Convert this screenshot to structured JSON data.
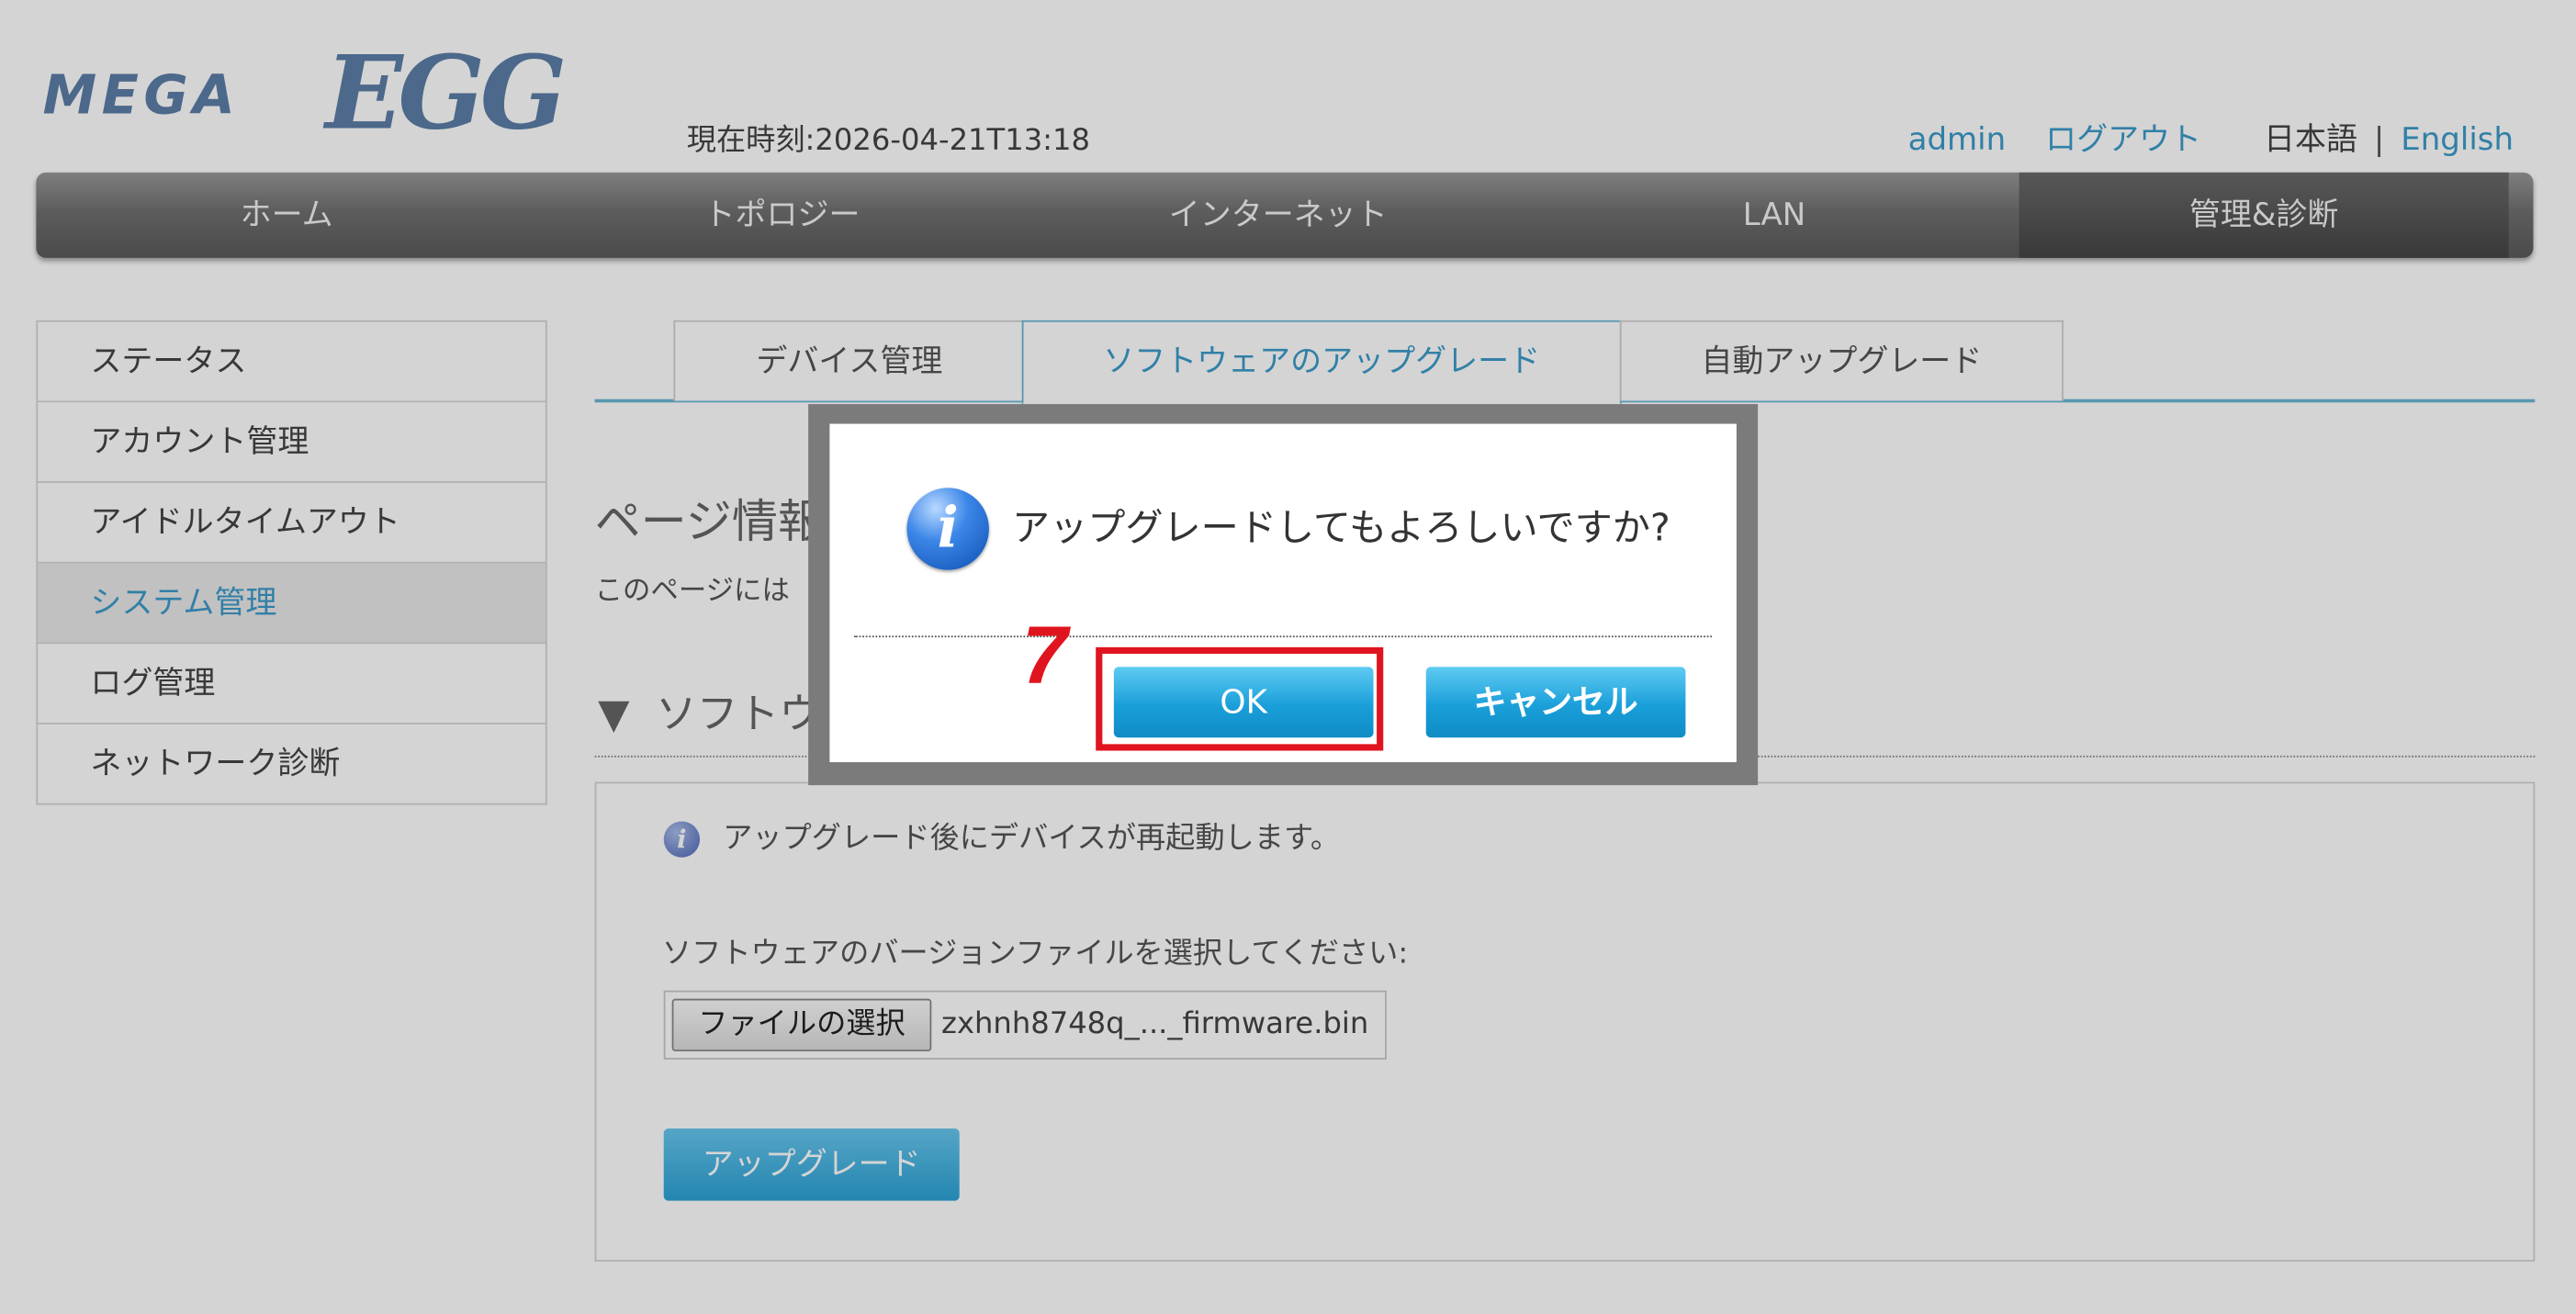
{
  "header": {
    "logo_mega": "MEGA",
    "logo_egg": "EGG",
    "clock": "現在時刻:2026-04-21T13:18",
    "user": "admin",
    "logout": "ログアウト",
    "lang_ja": "日本語",
    "lang_sep": "|",
    "lang_en": "English"
  },
  "nav": {
    "items": [
      {
        "label": "ホーム"
      },
      {
        "label": "トポロジー"
      },
      {
        "label": "インターネット"
      },
      {
        "label": "LAN"
      },
      {
        "label": "管理&診断"
      }
    ],
    "active_index": 4
  },
  "sidebar": {
    "items": [
      {
        "label": "ステータス"
      },
      {
        "label": "アカウント管理"
      },
      {
        "label": "アイドルタイムアウト"
      },
      {
        "label": "システム管理"
      },
      {
        "label": "ログ管理"
      },
      {
        "label": "ネットワーク診断"
      }
    ],
    "active_index": 3
  },
  "tabs": {
    "items": [
      {
        "label": "デバイス管理"
      },
      {
        "label": "ソフトウェアのアップグレード"
      },
      {
        "label": "自動アップグレード"
      }
    ],
    "active_index": 1
  },
  "main": {
    "title": "ページ情報",
    "description": "このページには",
    "section_arrow": "▼",
    "section_title": "ソフトウ",
    "info_text": "アップグレード後にデバイスが再起動します。",
    "file_label": "ソフトウェアのバージョンファイルを選択してください:",
    "file_button": "ファイルの選択",
    "file_name": "zxhnh8748q_..._firmware.bin",
    "upgrade_button": "アップグレード"
  },
  "dialog": {
    "icon": "info-icon",
    "message": "アップグレードしてもよろしいですか?",
    "ok_label": "OK",
    "cancel_label": "キャンセル"
  },
  "annotation": {
    "step_number": "7",
    "highlight_color": "#e0141e"
  },
  "colors": {
    "accent": "#3c9bc9",
    "button_blue": "#1a9fd9",
    "nav_gray": "#707070"
  }
}
